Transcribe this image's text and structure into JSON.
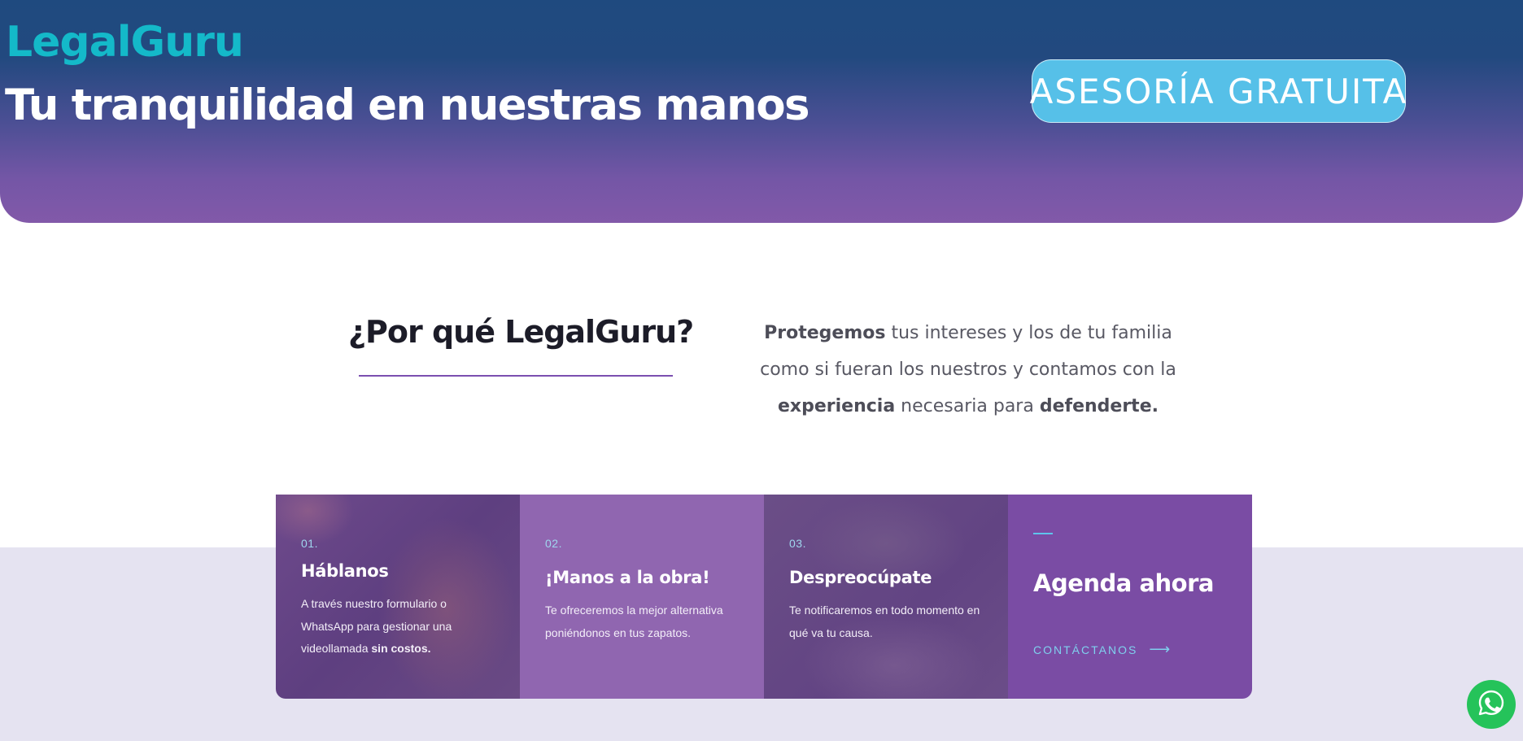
{
  "hero": {
    "brand": "LegalGuru",
    "title": "Tu tranquilidad en nuestras manos",
    "cta_label": "ASESORÍA GRATUITA"
  },
  "why": {
    "title": "¿Por qué LegalGuru?",
    "text": {
      "p1_bold": "Protegemos",
      "p1_rest": " tus intereses y los de tu familia como si fueran los nuestros y contamos con la ",
      "p2_bold": "experiencia",
      "p2_rest": " necesaria para ",
      "p3_bold": "defenderte."
    }
  },
  "cards": [
    {
      "num": "01.",
      "title": "Háblanos",
      "text": "A través nuestro formulario o WhatsApp para gestionar una videollamada ",
      "text_bold": "sin costos."
    },
    {
      "num": "02.",
      "title": "¡Manos a la obra!",
      "text": "Te ofreceremos la mejor alternativa poniéndonos en tus zapatos."
    },
    {
      "num": "03.",
      "title": "Despreocúpate",
      "text": "Te notificaremos en todo momento en qué va tu causa."
    }
  ],
  "agenda": {
    "title": "Agenda ahora",
    "link_label": "CONTÁCTANOS",
    "link_icon": "arrow-right-icon"
  },
  "whatsapp": {
    "icon": "whatsapp-icon",
    "color": "#25c35a"
  },
  "colors": {
    "brand": "#14b9c9",
    "cta": "#56c0e8",
    "accent_purple": "#7a4ca4",
    "band": "#e5e3f1"
  }
}
